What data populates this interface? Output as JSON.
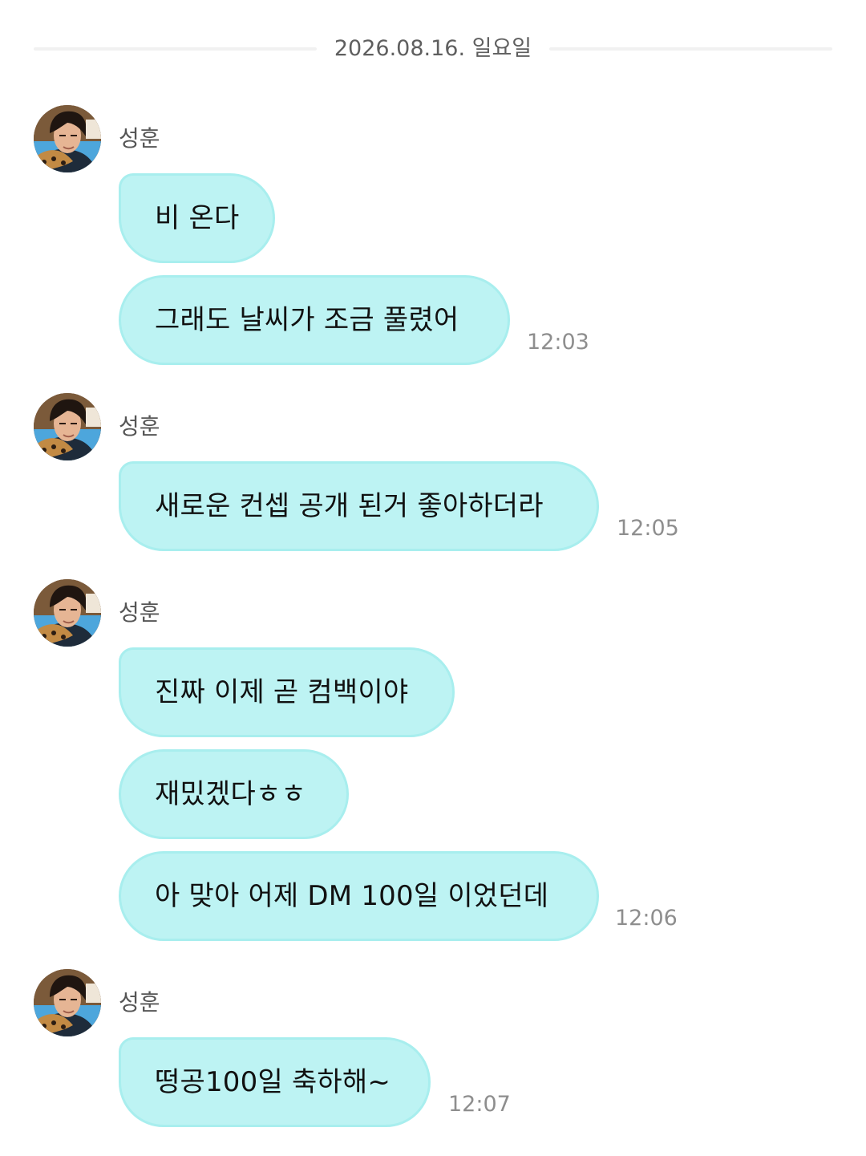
{
  "date_divider": "2026.08.16. 일요일",
  "sender": "성훈",
  "avatar_icon": "profile-photo",
  "colors": {
    "bubble_background": "#bdf3f3",
    "bubble_border": "#a8eeee",
    "date_line": "#f1f1f1",
    "timestamp": "#8e8e8e"
  },
  "groups": [
    {
      "sender_name": "성훈",
      "messages": [
        {
          "text": "비 온다"
        },
        {
          "text": "그래도 날씨가 조금 풀렸어"
        }
      ],
      "time": "12:03"
    },
    {
      "sender_name": "성훈",
      "messages": [
        {
          "text": "새로운 컨셉 공개 된거 좋아하더라"
        }
      ],
      "time": "12:05"
    },
    {
      "sender_name": "성훈",
      "messages": [
        {
          "text": "진짜 이제 곧 컴백이야"
        },
        {
          "text": "재밌겠다ㅎㅎ"
        },
        {
          "text": "아 맞아 어제 DM 100일 이었던데"
        }
      ],
      "time": "12:06"
    },
    {
      "sender_name": "성훈",
      "messages": [
        {
          "text": "떵공100일 축하해~"
        }
      ],
      "time": "12:07"
    }
  ]
}
